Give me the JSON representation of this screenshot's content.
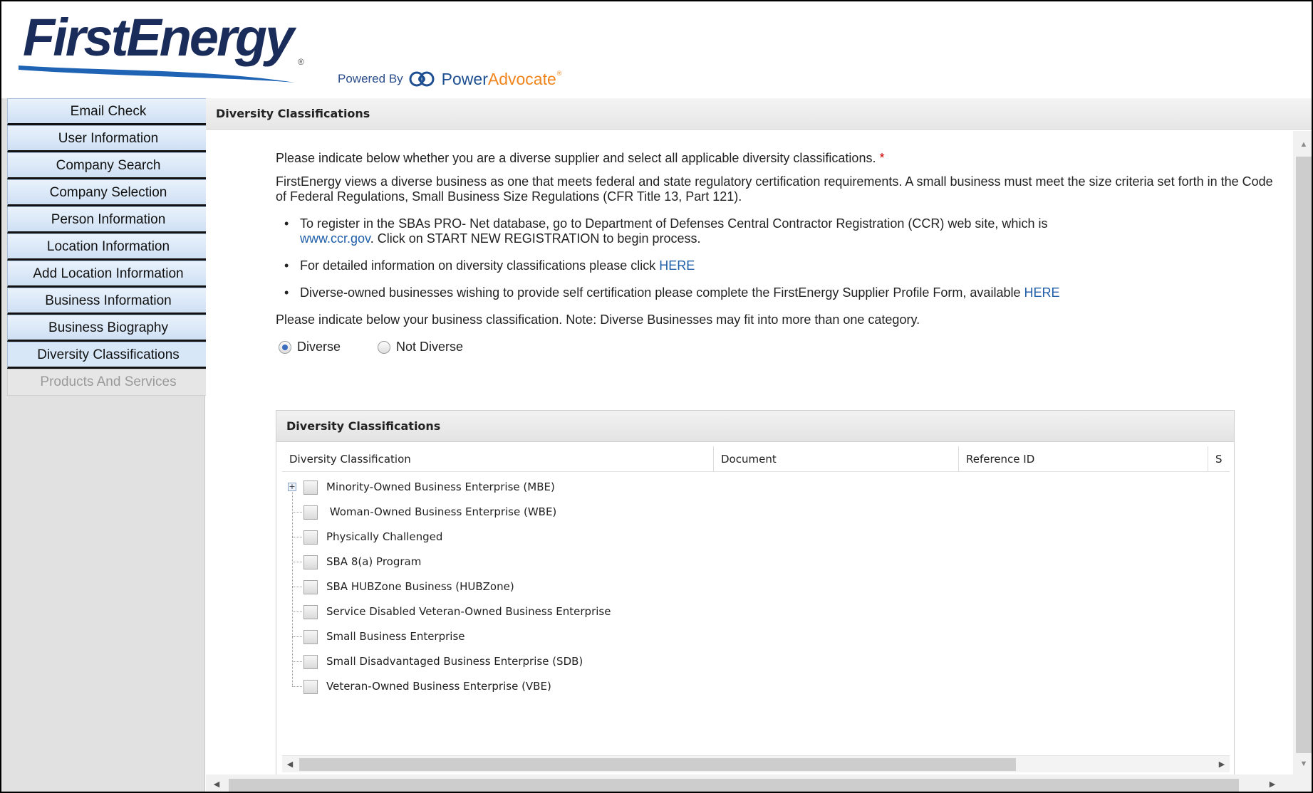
{
  "header": {
    "brand": "FirstEnergy",
    "brand_reg": "®",
    "powered_by": "Powered By",
    "partner_power": "Power",
    "partner_advocate": "Advocate",
    "partner_reg": "®",
    "brand_color": "#1a2c5a",
    "partner_blue": "#1d4f91",
    "partner_orange": "#f0851e"
  },
  "sidebar": {
    "items": [
      {
        "label": "Email Check",
        "state": "normal"
      },
      {
        "label": "User Information",
        "state": "normal"
      },
      {
        "label": "Company Search",
        "state": "normal"
      },
      {
        "label": "Company Selection",
        "state": "normal"
      },
      {
        "label": "Person Information",
        "state": "normal"
      },
      {
        "label": "Location Information",
        "state": "normal"
      },
      {
        "label": "Add Location Information",
        "state": "normal"
      },
      {
        "label": "Business Information",
        "state": "normal"
      },
      {
        "label": "Business Biography",
        "state": "normal"
      },
      {
        "label": "Diversity Classifications",
        "state": "active"
      },
      {
        "label": "Products And Services",
        "state": "disabled"
      }
    ]
  },
  "main": {
    "title": "Diversity Classifications",
    "intro": "Please indicate below whether you are a diverse supplier and select all applicable diversity classifications.",
    "required_mark": "*",
    "definition": "FirstEnergy views a diverse business as one that meets federal and state regulatory certification requirements. A small business must meet the size criteria set forth in the Code of Federal Regulations, Small Business Size Regulations (CFR Title 13, Part 121).",
    "bullets": {
      "b1_text": "To register in the SBAs PRO- Net database, go to Department of Defenses Central Contractor Registration (CCR) web site, which is",
      "b1_link": "www.ccr.gov",
      "b1_suffix": ". Click on START NEW REGISTRATION to begin process.",
      "b2_text": "For detailed information on diversity classifications please click",
      "b2_link": "HERE",
      "b3_text": "Diverse-owned businesses wishing to provide self certification please complete the FirstEnergy Supplier Profile Form, available",
      "b3_link": "HERE"
    },
    "classification_note": "Please indicate below your business classification. Note: Diverse Businesses may fit into more than one category.",
    "radios": {
      "diverse_label": "Diverse",
      "not_diverse_label": "Not Diverse",
      "selected": "Diverse"
    },
    "grid": {
      "title": "Diversity Classifications",
      "columns": [
        "Diversity Classification",
        "Document",
        "Reference ID",
        "S"
      ],
      "rows": [
        {
          "label": "Minority-Owned Business Enterprise (MBE)",
          "expandable": true,
          "checked": false
        },
        {
          "label": " Woman-Owned Business Enterprise (WBE)",
          "expandable": false,
          "checked": false
        },
        {
          "label": "Physically Challenged",
          "expandable": false,
          "checked": false
        },
        {
          "label": "SBA 8(a) Program",
          "expandable": false,
          "checked": false
        },
        {
          "label": "SBA HUBZone Business (HUBZone)",
          "expandable": false,
          "checked": false
        },
        {
          "label": "Service Disabled Veteran-Owned Business Enterprise",
          "expandable": false,
          "checked": false
        },
        {
          "label": "Small Business Enterprise",
          "expandable": false,
          "checked": false
        },
        {
          "label": "Small Disadvantaged Business Enterprise (SDB)",
          "expandable": false,
          "checked": false
        },
        {
          "label": "Veteran-Owned Business Enterprise (VBE)",
          "expandable": false,
          "checked": false
        }
      ]
    }
  },
  "icons": {
    "expand": "plus-expander-icon",
    "scroll_left": "◀",
    "scroll_right": "▶",
    "scroll_up": "▲",
    "scroll_down": "▼"
  }
}
